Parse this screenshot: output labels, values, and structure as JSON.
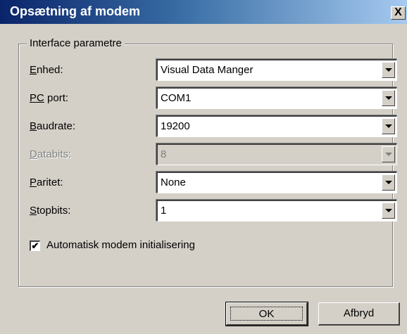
{
  "window": {
    "title": "Opsætning af modem",
    "close_label": "X"
  },
  "group": {
    "legend": "Interface parametre"
  },
  "fields": [
    {
      "label_underlined": "E",
      "label_rest": "nhed:",
      "value": "Visual Data Manger",
      "enabled": true
    },
    {
      "label_underlined": "PC",
      "label_rest": " port:",
      "value": "COM1",
      "enabled": true
    },
    {
      "label_underlined": "B",
      "label_rest": "audrate:",
      "value": "19200",
      "enabled": true
    },
    {
      "label_underlined": "D",
      "label_rest": "atabits:",
      "value": "8",
      "enabled": false
    },
    {
      "label_underlined": "P",
      "label_rest": "aritet:",
      "value": "None",
      "enabled": true
    },
    {
      "label_underlined": "S",
      "label_rest": "topbits:",
      "value": "1",
      "enabled": true
    }
  ],
  "auto_init": {
    "label": "Automatisk modem initialisering",
    "checked": true,
    "check_glyph": "✔"
  },
  "buttons": {
    "ok": "OK",
    "cancel": "Afbryd"
  },
  "icons": {
    "close": "close-icon",
    "dropdown": "chevron-down-icon",
    "check": "checkmark-icon"
  }
}
